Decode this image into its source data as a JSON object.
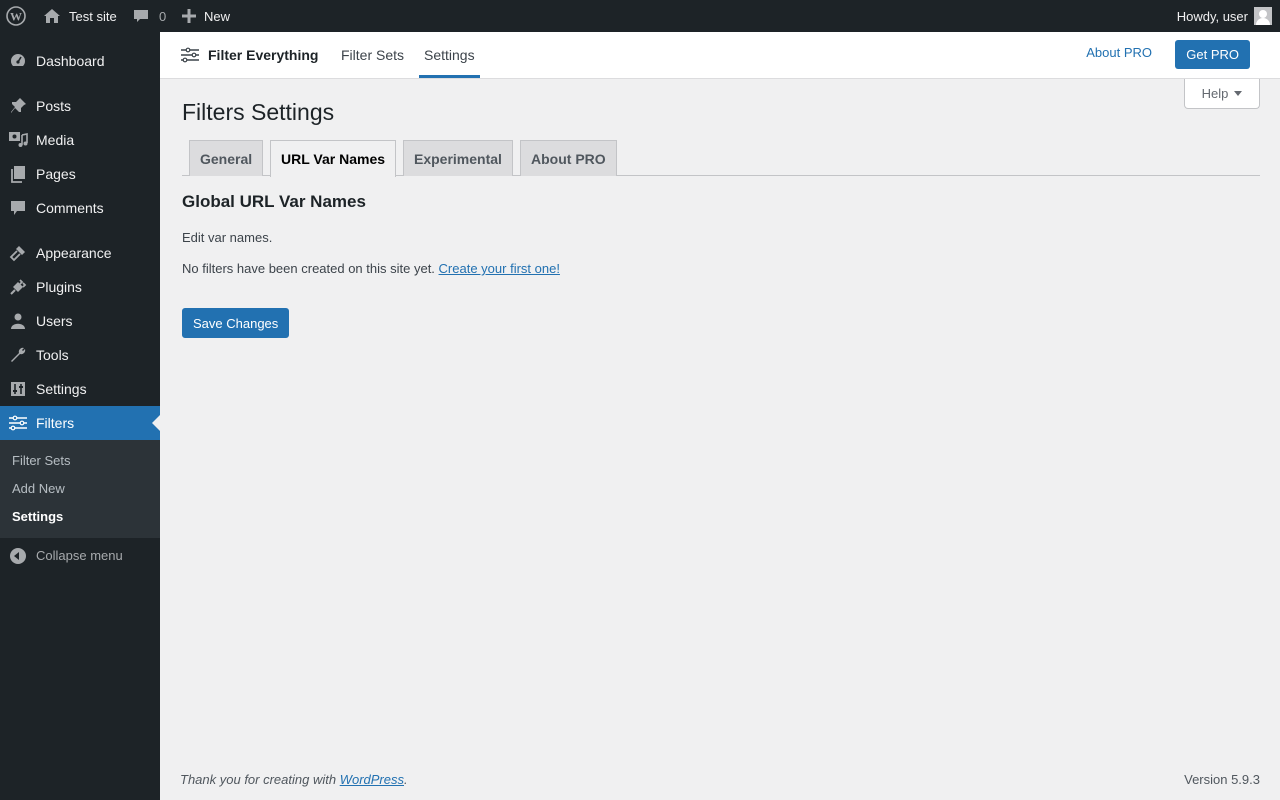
{
  "adminbar": {
    "site_name": "Test site",
    "comments_count": "0",
    "new_label": "New",
    "howdy": "Howdy, user"
  },
  "sidebar": {
    "items": [
      {
        "label": "Dashboard",
        "icon": "dashboard-icon"
      },
      {
        "label": "Posts",
        "icon": "pin-icon"
      },
      {
        "label": "Media",
        "icon": "media-icon"
      },
      {
        "label": "Pages",
        "icon": "pages-icon"
      },
      {
        "label": "Comments",
        "icon": "comment-icon"
      },
      {
        "label": "Appearance",
        "icon": "brush-icon"
      },
      {
        "label": "Plugins",
        "icon": "plugin-icon"
      },
      {
        "label": "Users",
        "icon": "user-icon"
      },
      {
        "label": "Tools",
        "icon": "wrench-icon"
      },
      {
        "label": "Settings",
        "icon": "settings-icon"
      },
      {
        "label": "Filters",
        "icon": "filters-icon"
      }
    ],
    "submenu": [
      "Filter Sets",
      "Add New",
      "Settings"
    ],
    "collapse": "Collapse menu"
  },
  "plugin_header": {
    "brand": "Filter Everything",
    "nav": [
      "Filter Sets",
      "Settings"
    ],
    "about_pro": "About PRO",
    "get_pro": "Get PRO"
  },
  "help": "Help",
  "page": {
    "title": "Filters Settings",
    "tabs": [
      "General",
      "URL Var Names",
      "Experimental",
      "About PRO"
    ],
    "active_tab": "URL Var Names",
    "section_title": "Global URL Var Names",
    "description": "Edit var names.",
    "notice_text": "No filters have been created on this site yet.",
    "notice_link": "Create your first one!",
    "save_button": "Save Changes"
  },
  "footer": {
    "thanks_prefix": "Thank you for creating with",
    "wordpress_link": "WordPress",
    "thanks_suffix": ".",
    "version": "Version 5.9.3"
  },
  "colors": {
    "accent": "#2271b1",
    "adminbar_bg": "#1d2327",
    "page_bg": "#f0f0f1"
  }
}
